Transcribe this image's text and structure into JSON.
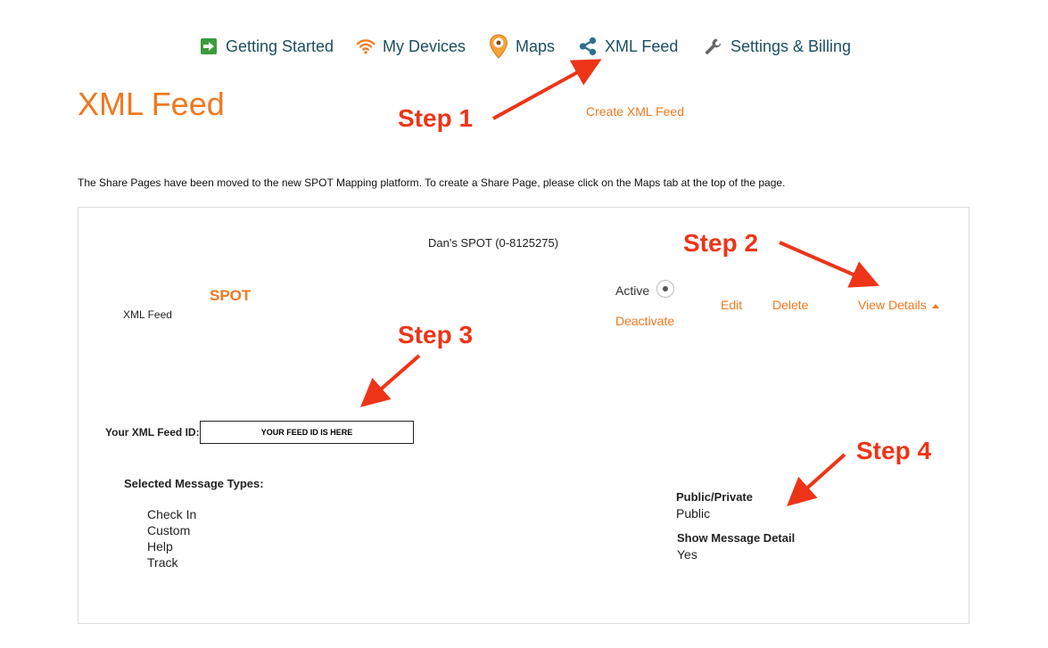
{
  "nav": {
    "items": [
      {
        "label": "Getting Started",
        "icon": "arrow-right-icon"
      },
      {
        "label": "My Devices",
        "icon": "wifi-icon"
      },
      {
        "label": "Maps",
        "icon": "map-pin-icon"
      },
      {
        "label": "XML Feed",
        "icon": "share-icon"
      },
      {
        "label": "Settings & Billing",
        "icon": "wrench-icon"
      }
    ]
  },
  "header": {
    "title": "XML Feed",
    "create_link": "Create XML Feed",
    "notice": "The Share Pages have been moved to the new SPOT Mapping platform. To create a Share Page, please click on the Maps tab at the top of the page."
  },
  "feed": {
    "device_name": "Dan's SPOT (0-8125275)",
    "device_type": "SPOT",
    "feed_type": "XML Feed",
    "active_label": "Active",
    "deactivate_label": "Deactivate",
    "edit_label": "Edit",
    "delete_label": "Delete",
    "view_details_label": "View Details",
    "feed_id_label": "Your XML Feed ID:",
    "feed_id_value": "YOUR FEED ID IS HERE",
    "message_types_label": "Selected Message Types:",
    "message_types": [
      "Check In",
      "Custom",
      "Help",
      "Track"
    ],
    "public_private_label": "Public/Private",
    "public_private_value": "Public",
    "show_detail_label": "Show Message Detail",
    "show_detail_value": "Yes"
  },
  "annotations": {
    "step1": "Step 1",
    "step2": "Step 2",
    "step3": "Step 3",
    "step4": "Step 4"
  },
  "colors": {
    "accent": "#f0781e",
    "nav_text": "#1d4e5f",
    "annotation": "#ee3418"
  }
}
